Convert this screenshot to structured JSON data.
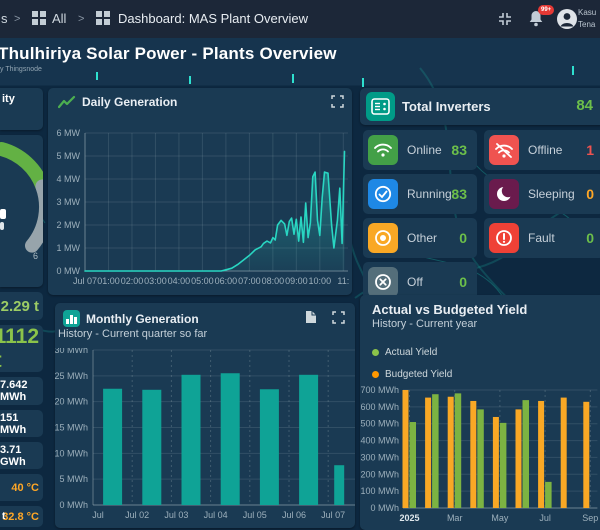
{
  "theme": {
    "topbar_bg": "#1c2738",
    "card_bg": "#1a3a53",
    "page_bg": "#0d2840",
    "accent_teal": "#1fd0bd",
    "bar_teal": "#0fa396",
    "green": "#6cbf4a",
    "orange": "#ffa726",
    "red": "#ef5350",
    "blue": "#1e88e5"
  },
  "topbar": {
    "breadcrumb_fragment": "s",
    "separator": ">",
    "all_label": "All",
    "dashboard_label": "Dashboard: MAS Plant Overview",
    "notifications_badge": "99+",
    "user_line1": "Kasu",
    "user_line2": "Tena"
  },
  "header": {
    "title": "Thulhiriya Solar Power - Plants Overview",
    "subtitle": "y Thingsnode"
  },
  "left_panel": {
    "top_card_label": "ity",
    "gauge": {
      "max_label": "6",
      "arc_color": "#63b144",
      "track_color": "#97a4ab"
    },
    "metrics": [
      {
        "value": "2.29 t",
        "color": "#9ccc65",
        "size": 15
      },
      {
        "value": "1112 t",
        "color": "#8bc34a",
        "size": 21
      },
      {
        "value": "7.642 MWh",
        "color": "#ffffff",
        "size": 11
      },
      {
        "value": "151 MWh",
        "color": "#ffffff",
        "size": 11
      },
      {
        "value": "3.71 GWh",
        "color": "#ffffff",
        "size": 11
      },
      {
        "value": "40 °C",
        "color": "#ffa726",
        "size": 11
      },
      {
        "value": "32.8 °C",
        "color": "#ffa726",
        "size": 11,
        "prefix": "t"
      }
    ]
  },
  "inverters": {
    "title": "Total Inverters",
    "total": "84",
    "total_color": "#6cbf4a",
    "header_icon_bg": "#009b87",
    "tiles": [
      {
        "label": "Online",
        "value": "83",
        "value_color": "#6cbf4a",
        "icon": "wifi-icon",
        "icon_bg": "#43a047"
      },
      {
        "label": "Offline",
        "value": "1",
        "value_color": "#ef5350",
        "icon": "wifi-off-icon",
        "icon_bg": "#ef5350"
      },
      {
        "label": "Running",
        "value": "83",
        "value_color": "#6cbf4a",
        "icon": "check-circle-icon",
        "icon_bg": "#1e88e5"
      },
      {
        "label": "Sleeping",
        "value": "0",
        "value_color": "#ffa726",
        "icon": "moon-icon",
        "icon_bg": "#6a1b4d"
      },
      {
        "label": "Other",
        "value": "0",
        "value_color": "#6cbf4a",
        "icon": "circle-dot-icon",
        "icon_bg": "#f9a825"
      },
      {
        "label": "Fault",
        "value": "0",
        "value_color": "#6cbf4a",
        "icon": "alert-circle-icon",
        "icon_bg": "#ef4136"
      },
      {
        "label": "Off",
        "value": "0",
        "value_color": "#6cbf4a",
        "icon": "x-circle-icon",
        "icon_bg": "#546e7a"
      }
    ]
  },
  "chart_data": [
    {
      "id": "daily",
      "type": "area",
      "title": "Daily Generation",
      "ylabel": "MW",
      "ylim": [
        0,
        6
      ],
      "y_tick_step": 1,
      "y_suffix": " MW",
      "grid": true,
      "x_domain": [
        0,
        11.2
      ],
      "x_ticks": [
        "Jul 07",
        "01:00",
        "02:00",
        "03:00",
        "04:00",
        "05:00",
        "06:00",
        "07:00",
        "08:00",
        "09:00",
        "10:00",
        "11:"
      ],
      "line_color": "#29d6c2",
      "fill_top": "rgba(41,214,194,0.45)",
      "fill_bottom": "rgba(41,214,194,0.04)",
      "points": [
        [
          0,
          0
        ],
        [
          1,
          0
        ],
        [
          2,
          0
        ],
        [
          3,
          0
        ],
        [
          4,
          0
        ],
        [
          5,
          0
        ],
        [
          5.8,
          0
        ],
        [
          6,
          0.05
        ],
        [
          6.25,
          0.12
        ],
        [
          6.5,
          0.28
        ],
        [
          6.75,
          0.48
        ],
        [
          7,
          0.68
        ],
        [
          7.25,
          0.92
        ],
        [
          7.5,
          1.05
        ],
        [
          7.6,
          1.2
        ],
        [
          7.75,
          1.3
        ],
        [
          7.9,
          1.22
        ],
        [
          8,
          1.45
        ],
        [
          8.1,
          1.35
        ],
        [
          8.2,
          2.0
        ],
        [
          8.35,
          2.2
        ],
        [
          8.5,
          2.05
        ],
        [
          8.6,
          1.55
        ],
        [
          8.7,
          2.15
        ],
        [
          8.8,
          2.3
        ],
        [
          8.9,
          1.6
        ],
        [
          9,
          2.25
        ],
        [
          9.1,
          1.3
        ],
        [
          9.2,
          2.35
        ],
        [
          9.3,
          1.25
        ],
        [
          9.4,
          2.95
        ],
        [
          9.5,
          1.45
        ],
        [
          9.6,
          2.1
        ],
        [
          9.7,
          4.1
        ],
        [
          9.8,
          4.3
        ],
        [
          9.9,
          2.2
        ],
        [
          10,
          1.55
        ],
        [
          10.1,
          3.2
        ],
        [
          10.2,
          4.3
        ],
        [
          10.35,
          4.25
        ],
        [
          10.5,
          2.0
        ],
        [
          10.6,
          1.0
        ],
        [
          10.75,
          2.2
        ],
        [
          10.85,
          3.6
        ],
        [
          10.95,
          1.2
        ],
        [
          11.05,
          5.2
        ]
      ]
    },
    {
      "id": "monthly",
      "type": "bar",
      "title": "Monthly Generation",
      "subtitle": "History - Current quarter so far",
      "categories": [
        "Jul",
        "Jul 02",
        "Jul 03",
        "Jul 04",
        "Jul 05",
        "Jul 06",
        "Jul 07"
      ],
      "values": [
        22.5,
        22.3,
        25.2,
        25.5,
        22.4,
        25.2,
        7.7
      ],
      "ylim": [
        0,
        30
      ],
      "y_tick_step": 5,
      "y_suffix": " MWh",
      "bar_color": "#0fa396",
      "grid": true
    },
    {
      "id": "yield",
      "type": "grouped-bar",
      "title": "Actual vs Budgeted Yield",
      "subtitle": "History - Current year",
      "legend": [
        {
          "name": "Actual Yield",
          "color": "#8bc34a"
        },
        {
          "name": "Budgeted Yield",
          "color": "#ff9800"
        }
      ],
      "months": 9,
      "x_ticks": [
        {
          "index": 0,
          "label": "2025",
          "bold": true
        },
        {
          "index": 2,
          "label": "Mar"
        },
        {
          "index": 4,
          "label": "May"
        },
        {
          "index": 6,
          "label": "Jul"
        },
        {
          "index": 8,
          "label": "Sep"
        }
      ],
      "series": [
        {
          "name": "Budgeted Yield",
          "color": "#f9a825",
          "values": [
            700,
            655,
            660,
            635,
            540,
            585,
            635,
            655,
            630
          ]
        },
        {
          "name": "Actual Yield",
          "color": "#7cb342",
          "values": [
            510,
            675,
            680,
            585,
            505,
            640,
            155,
            null,
            null
          ]
        }
      ],
      "ylim": [
        0,
        700
      ],
      "y_tick_step": 100,
      "y_suffix": " MWh",
      "grid": true
    }
  ]
}
